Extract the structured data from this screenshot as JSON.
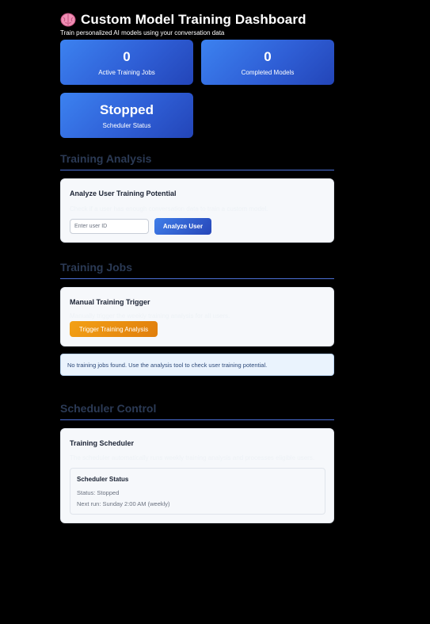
{
  "header": {
    "title": "Custom Model Training Dashboard",
    "subtitle": "Train personalized AI models using your conversation data"
  },
  "stats": [
    {
      "value": "0",
      "label": "Active Training Jobs"
    },
    {
      "value": "0",
      "label": "Completed Models"
    },
    {
      "value": "Stopped",
      "label": "Scheduler Status"
    }
  ],
  "analysis": {
    "heading": "Training Analysis",
    "card_title": "Analyze User Training Potential",
    "card_desc": "Check if a user has enough conversation data to train a custom model.",
    "input_placeholder": "Enter user ID",
    "button_label": "Analyze User"
  },
  "jobs": {
    "heading": "Training Jobs",
    "card_title": "Manual Training Trigger",
    "card_desc": "Manually trigger the weekly training analysis for all users.",
    "button_label": "Trigger Training Analysis",
    "empty_message": "No training jobs found. Use the analysis tool to check user training potential."
  },
  "scheduler": {
    "heading": "Scheduler Control",
    "card_title": "Training Scheduler",
    "card_desc": "The scheduler automatically runs weekly training analysis and processes eligible users.",
    "status_title": "Scheduler Status",
    "status_line": "Status: Stopped",
    "next_run_line": "Next run: Sunday 2:00 AM (weekly)"
  },
  "colors": {
    "background": "#000000",
    "stat_card_gradient_start": "#3c82f0",
    "stat_card_gradient_end": "#2345b8",
    "section_heading": "#2b3a55",
    "accent_line": "#4c6fd6",
    "primary_button": "#2f5fd6",
    "warning_button": "#f3a116",
    "info_box": "#eaf3fd"
  },
  "icons": {
    "title_icon": "brain-icon"
  }
}
